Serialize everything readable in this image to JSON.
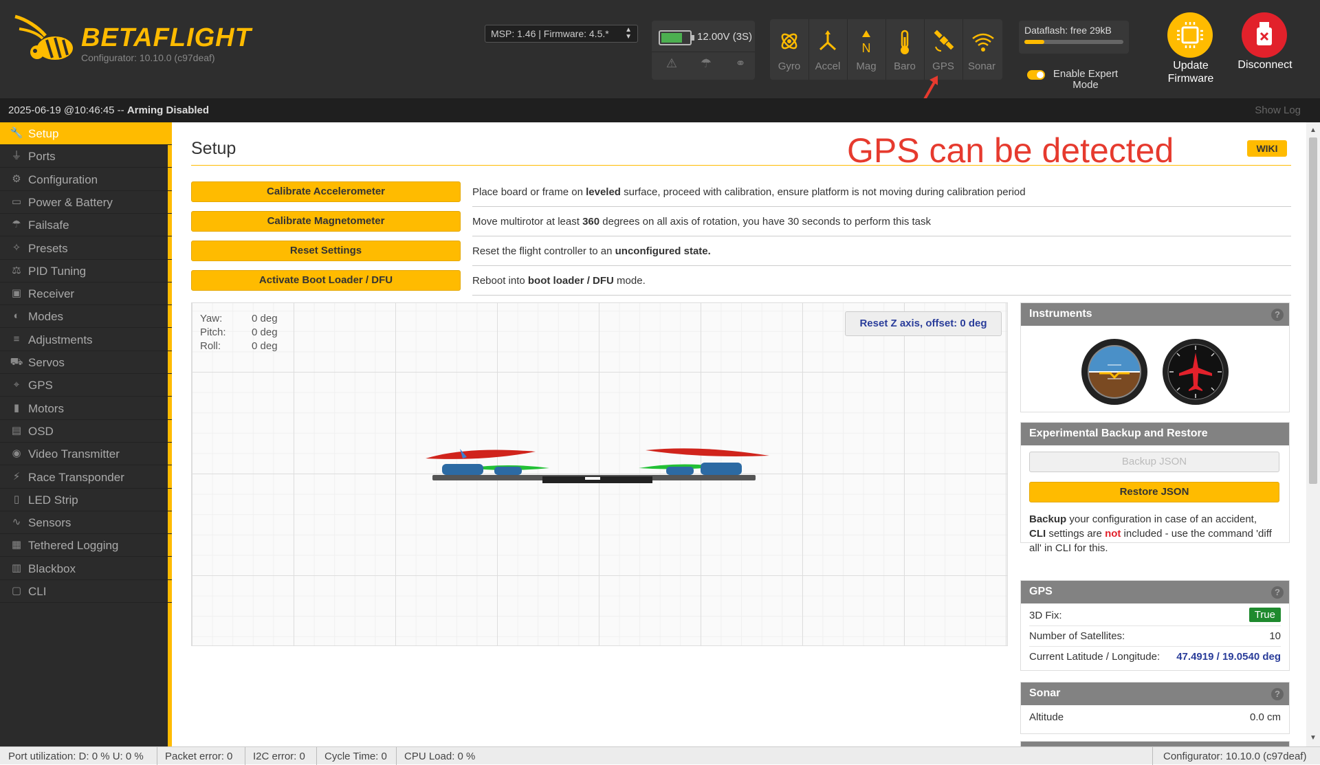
{
  "header": {
    "brand": "BETAFLIGHT",
    "version": "Configurator: 10.10.0 (c97deaf)",
    "msp_select": "MSP: 1.46 | Firmware: 4.5.*",
    "battery": {
      "voltage": "12.00V (3S)",
      "level_fraction": 0.75,
      "color": "#4caf50"
    },
    "sensors": [
      {
        "label": "Gyro",
        "icon": "gyro-icon"
      },
      {
        "label": "Accel",
        "icon": "accel-icon"
      },
      {
        "label": "Mag",
        "icon": "mag-icon"
      },
      {
        "label": "Baro",
        "icon": "baro-icon"
      },
      {
        "label": "GPS",
        "icon": "gps-icon"
      },
      {
        "label": "Sonar",
        "icon": "sonar-icon"
      }
    ],
    "dataflash": {
      "label": "Dataflash: free 29kB",
      "used_fraction": 0.2
    },
    "expert_mode_label": "Enable Expert Mode",
    "update_firmware_label": "Update Firmware",
    "disconnect_label": "Disconnect",
    "accent_color": "#ffbb00"
  },
  "infobar": {
    "timestamp": "2025-06-19 @10:46:45",
    "separator": " -- ",
    "status": "Arming Disabled",
    "show_log": "Show Log"
  },
  "sidebar": {
    "items": [
      {
        "label": "Setup",
        "icon": "wrench-icon",
        "active": true
      },
      {
        "label": "Ports",
        "icon": "plug-icon"
      },
      {
        "label": "Configuration",
        "icon": "gear-icon"
      },
      {
        "label": "Power & Battery",
        "icon": "battery-icon"
      },
      {
        "label": "Failsafe",
        "icon": "parachute-icon"
      },
      {
        "label": "Presets",
        "icon": "magic-wand-icon"
      },
      {
        "label": "PID Tuning",
        "icon": "pid-icon"
      },
      {
        "label": "Receiver",
        "icon": "receiver-icon"
      },
      {
        "label": "Modes",
        "icon": "toggle-icon"
      },
      {
        "label": "Adjustments",
        "icon": "sliders-icon"
      },
      {
        "label": "Servos",
        "icon": "servo-icon"
      },
      {
        "label": "GPS",
        "icon": "satellite-icon"
      },
      {
        "label": "Motors",
        "icon": "motor-icon"
      },
      {
        "label": "OSD",
        "icon": "osd-icon"
      },
      {
        "label": "Video Transmitter",
        "icon": "broadcast-icon"
      },
      {
        "label": "Race Transponder",
        "icon": "transponder-icon"
      },
      {
        "label": "LED Strip",
        "icon": "led-icon"
      },
      {
        "label": "Sensors",
        "icon": "pulse-icon"
      },
      {
        "label": "Tethered Logging",
        "icon": "log-icon"
      },
      {
        "label": "Blackbox",
        "icon": "blackbox-icon"
      },
      {
        "label": "CLI",
        "icon": "terminal-icon"
      }
    ]
  },
  "main": {
    "title": "Setup",
    "annotation": "GPS can be detected",
    "wiki": "WIKI",
    "calibration": [
      {
        "button": "Calibrate Accelerometer",
        "desc_before": "Place board or frame on ",
        "desc_bold": "leveled",
        "desc_after": " surface, proceed with calibration, ensure platform is not moving during calibration period"
      },
      {
        "button": "Calibrate Magnetometer",
        "desc_before": "Move multirotor at least ",
        "desc_bold": "360",
        "desc_after": " degrees on all axis of rotation, you have 30 seconds to perform this task"
      },
      {
        "button": "Reset Settings",
        "desc_before": "Reset the flight controller to an ",
        "desc_bold": "unconfigured state.",
        "desc_after": ""
      },
      {
        "button": "Activate Boot Loader / DFU",
        "desc_before": "Reboot into ",
        "desc_bold": "boot loader / DFU",
        "desc_after": " mode."
      }
    ],
    "attitude": {
      "yaw_label": "Yaw:",
      "yaw": "0 deg",
      "pitch_label": "Pitch:",
      "pitch": "0 deg",
      "roll_label": "Roll:",
      "roll": "0 deg"
    },
    "reset_z": "Reset Z axis, offset: 0 deg"
  },
  "panels": {
    "instruments": {
      "title": "Instruments"
    },
    "backup": {
      "title": "Experimental Backup and Restore",
      "backup_btn": "Backup JSON",
      "restore_btn": "Restore JSON",
      "note_b1": "Backup",
      "note_t1": " your configuration in case of an accident,",
      "note_b2": "CLI",
      "note_t2": " settings are ",
      "note_not": "not",
      "note_t3": " included - use the command 'diff all' in CLI for this."
    },
    "gps": {
      "title": "GPS",
      "fix_label": "3D Fix:",
      "fix_value": "True",
      "sats_label": "Number of Satellites:",
      "sats_value": "10",
      "latlon_label": "Current Latitude / Longitude:",
      "latlon_value": "47.4919 / 19.0540 deg"
    },
    "sonar": {
      "title": "Sonar",
      "alt_label": "Altitude",
      "alt_value": "0.0 cm"
    }
  },
  "statusbar": {
    "port_util": "Port utilization: D: 0 % U: 0 %",
    "packet_error": "Packet error: 0",
    "i2c_error": "I2C error: 0",
    "cycle_time": "Cycle Time: 0",
    "cpu_load": "CPU Load: 0 %",
    "configurator": "Configurator: 10.10.0 (c97deaf)"
  }
}
